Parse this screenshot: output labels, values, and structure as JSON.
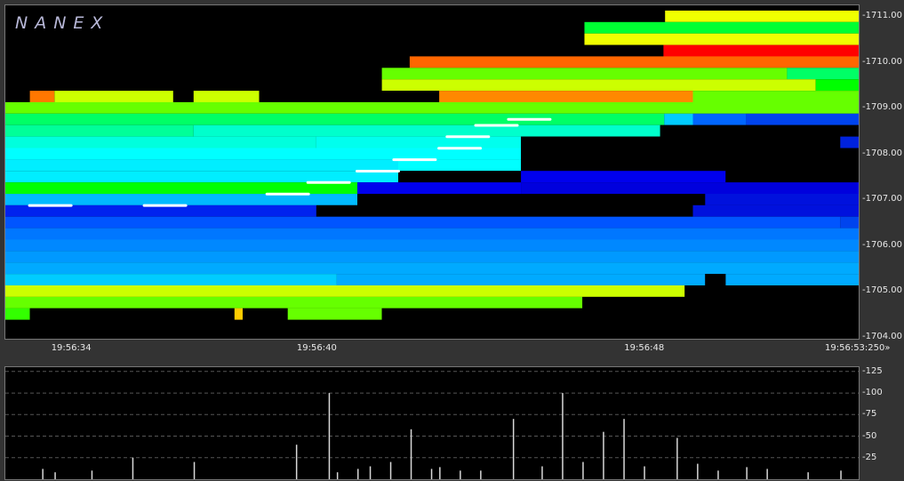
{
  "brand": "NANEX",
  "chart_data": [
    {
      "type": "heatmap",
      "title": "",
      "xlabel": "",
      "ylabel": "",
      "x_range": [
        "19:56:32.4",
        "19:56:53.250"
      ],
      "ylim": [
        1703.96,
        1711.24
      ],
      "grid": false,
      "y_ticks": [
        1704.0,
        1705.0,
        1706.0,
        1707.0,
        1708.0,
        1709.0,
        1710.0,
        1711.0
      ],
      "y_tick_labels": [
        "-1704.00",
        "-1705.00",
        "-1706.00",
        "-1707.00",
        "-1708.00",
        "-1709.00",
        "-1710.00",
        "-1711.00"
      ],
      "x_ticks": [
        34.0,
        40.0,
        48.0,
        53.25
      ],
      "x_tick_labels": [
        "19:56:34",
        "19:56:40",
        "19:56:48",
        "19:56:53:250»"
      ],
      "color_scale_rows": [
        {
          "price": 1711.0,
          "cells": [
            [
              48.52,
              53.25,
              "#f0ff00"
            ]
          ]
        },
        {
          "price": 1710.75,
          "cells": [
            [
              46.55,
              53.25,
              "#00ff33"
            ]
          ]
        },
        {
          "price": 1710.5,
          "cells": [
            [
              46.55,
              53.25,
              "#f0ff00"
            ]
          ]
        },
        {
          "price": 1710.25,
          "cells": [
            [
              46.55,
              48.48,
              "#000000"
            ],
            [
              48.48,
              53.25,
              "#ff0000"
            ]
          ]
        },
        {
          "price": 1710.0,
          "cells": [
            [
              42.28,
              53.25,
              "#ff6600"
            ]
          ]
        },
        {
          "price": 1709.75,
          "cells": [
            [
              41.6,
              51.5,
              "#66ff00"
            ],
            [
              51.5,
              53.25,
              "#00ff66"
            ]
          ]
        },
        {
          "price": 1709.5,
          "cells": [
            [
              41.6,
              52.2,
              "#ccff00"
            ],
            [
              52.2,
              53.25,
              "#00ff00"
            ]
          ]
        },
        {
          "price": 1709.25,
          "cells": [
            [
              33.0,
              33.6,
              "#ff7700"
            ],
            [
              33.6,
              36.5,
              "#ccff00"
            ],
            [
              37.0,
              38.6,
              "#ccff00"
            ],
            [
              41.6,
              43.0,
              "#000000"
            ],
            [
              43.0,
              49.2,
              "#ff8800"
            ],
            [
              49.2,
              53.25,
              "#66ff00"
            ]
          ]
        },
        {
          "price": 1709.0,
          "cells": [
            [
              32.4,
              53.25,
              "#66ff00"
            ]
          ]
        },
        {
          "price": 1708.75,
          "cells": [
            [
              32.4,
              48.5,
              "#00ff66"
            ],
            [
              48.5,
              49.2,
              "#00ccff"
            ],
            [
              49.2,
              50.5,
              "#0066ff"
            ],
            [
              50.5,
              53.25,
              "#0044ee"
            ]
          ]
        },
        {
          "price": 1708.5,
          "cells": [
            [
              32.4,
              37.0,
              "#00ff99"
            ],
            [
              37.0,
              48.4,
              "#00ffcc"
            ],
            [
              48.4,
              53.25,
              "#000000"
            ]
          ]
        },
        {
          "price": 1708.25,
          "cells": [
            [
              32.4,
              40.0,
              "#00ffdd"
            ],
            [
              40.0,
              45.0,
              "#00ffee"
            ],
            [
              45.0,
              52.8,
              "#000000"
            ],
            [
              52.8,
              53.25,
              "#0022dd"
            ]
          ]
        },
        {
          "price": 1708.0,
          "cells": [
            [
              32.4,
              45.0,
              "#00ffff"
            ],
            [
              45.0,
              53.25,
              "#000000"
            ]
          ]
        },
        {
          "price": 1707.75,
          "cells": [
            [
              32.4,
              42.0,
              "#00eeff"
            ],
            [
              42.0,
              45.0,
              "#00ffff"
            ],
            [
              45.0,
              53.25,
              "#000000"
            ]
          ]
        },
        {
          "price": 1707.5,
          "cells": [
            [
              32.4,
              42.0,
              "#00eeff"
            ],
            [
              42.0,
              45.0,
              "#000000"
            ],
            [
              45.0,
              50.0,
              "#0000ee"
            ],
            [
              50.0,
              53.25,
              "#000000"
            ]
          ]
        },
        {
          "price": 1707.25,
          "cells": [
            [
              32.4,
              41.0,
              "#00ff00"
            ],
            [
              41.0,
              45.0,
              "#0000ee"
            ],
            [
              45.0,
              53.25,
              "#0000dd"
            ]
          ]
        },
        {
          "price": 1707.0,
          "cells": [
            [
              32.4,
              41.0,
              "#00bbff"
            ],
            [
              41.0,
              49.5,
              "#000000"
            ],
            [
              49.5,
              53.25,
              "#0011dd"
            ]
          ]
        },
        {
          "price": 1706.75,
          "cells": [
            [
              32.4,
              40.0,
              "#0022ee"
            ],
            [
              40.0,
              49.2,
              "#000000"
            ],
            [
              49.2,
              53.25,
              "#0011dd"
            ]
          ]
        },
        {
          "price": 1706.5,
          "cells": [
            [
              32.4,
              52.8,
              "#0055ff"
            ],
            [
              52.8,
              53.25,
              "#0044ee"
            ]
          ]
        },
        {
          "price": 1706.25,
          "cells": [
            [
              32.4,
              53.25,
              "#0077ff"
            ]
          ]
        },
        {
          "price": 1706.0,
          "cells": [
            [
              32.4,
              53.25,
              "#0088ff"
            ]
          ]
        },
        {
          "price": 1705.75,
          "cells": [
            [
              32.4,
              53.25,
              "#0099ff"
            ]
          ]
        },
        {
          "price": 1705.5,
          "cells": [
            [
              32.4,
              53.25,
              "#00aaff"
            ]
          ]
        },
        {
          "price": 1705.25,
          "cells": [
            [
              32.4,
              40.5,
              "#00ccff"
            ],
            [
              40.5,
              49.5,
              "#00aaff"
            ],
            [
              49.5,
              50.0,
              "#000000"
            ],
            [
              50.0,
              53.25,
              "#00aaff"
            ]
          ]
        },
        {
          "price": 1705.0,
          "cells": [
            [
              32.4,
              49.0,
              "#ccff00"
            ],
            [
              49.0,
              53.25,
              "#000000"
            ]
          ]
        },
        {
          "price": 1704.75,
          "cells": [
            [
              32.4,
              46.5,
              "#66ff00"
            ],
            [
              46.5,
              53.25,
              "#000000"
            ]
          ]
        },
        {
          "price": 1704.5,
          "cells": [
            [
              32.4,
              33.0,
              "#33ff00"
            ],
            [
              33.0,
              38.0,
              "#000000"
            ],
            [
              38.0,
              38.2,
              "#ffcc00"
            ],
            [
              38.2,
              39.3,
              "#000000"
            ],
            [
              39.3,
              41.6,
              "#66ff00"
            ],
            [
              41.6,
              53.25,
              "#000000"
            ]
          ]
        }
      ],
      "trade_prints": [
        {
          "x": 45.2,
          "price": 1708.75
        },
        {
          "x": 44.4,
          "price": 1708.62
        },
        {
          "x": 43.7,
          "price": 1708.37
        },
        {
          "x": 43.5,
          "price": 1708.12
        },
        {
          "x": 42.4,
          "price": 1707.87
        },
        {
          "x": 41.5,
          "price": 1707.62
        },
        {
          "x": 40.3,
          "price": 1707.37
        },
        {
          "x": 39.3,
          "price": 1707.12
        },
        {
          "x": 36.3,
          "price": 1706.87
        },
        {
          "x": 33.5,
          "price": 1706.87
        }
      ]
    },
    {
      "type": "bar",
      "title": "",
      "ylabel": "",
      "ylim": [
        0,
        125
      ],
      "y_ticks": [
        25,
        50,
        75,
        100,
        125
      ],
      "y_tick_labels": [
        "-25",
        "-50",
        "-75",
        "-100",
        "-125"
      ],
      "grid": true,
      "volume_bars": [
        {
          "x": 33.3,
          "v": 12
        },
        {
          "x": 33.6,
          "v": 8
        },
        {
          "x": 34.5,
          "v": 10
        },
        {
          "x": 35.5,
          "v": 25
        },
        {
          "x": 37.0,
          "v": 20
        },
        {
          "x": 39.5,
          "v": 40
        },
        {
          "x": 40.3,
          "v": 100
        },
        {
          "x": 40.5,
          "v": 8
        },
        {
          "x": 41.0,
          "v": 12
        },
        {
          "x": 41.3,
          "v": 15
        },
        {
          "x": 41.8,
          "v": 20
        },
        {
          "x": 42.3,
          "v": 58
        },
        {
          "x": 42.8,
          "v": 12
        },
        {
          "x": 43.0,
          "v": 14
        },
        {
          "x": 43.5,
          "v": 10
        },
        {
          "x": 44.0,
          "v": 10
        },
        {
          "x": 44.8,
          "v": 70
        },
        {
          "x": 45.5,
          "v": 15
        },
        {
          "x": 46.0,
          "v": 100
        },
        {
          "x": 46.5,
          "v": 20
        },
        {
          "x": 47.0,
          "v": 55
        },
        {
          "x": 47.5,
          "v": 70
        },
        {
          "x": 48.0,
          "v": 15
        },
        {
          "x": 48.8,
          "v": 48
        },
        {
          "x": 49.3,
          "v": 18
        },
        {
          "x": 49.8,
          "v": 10
        },
        {
          "x": 50.5,
          "v": 14
        },
        {
          "x": 51.0,
          "v": 12
        },
        {
          "x": 52.0,
          "v": 8
        },
        {
          "x": 52.8,
          "v": 10
        }
      ]
    }
  ]
}
